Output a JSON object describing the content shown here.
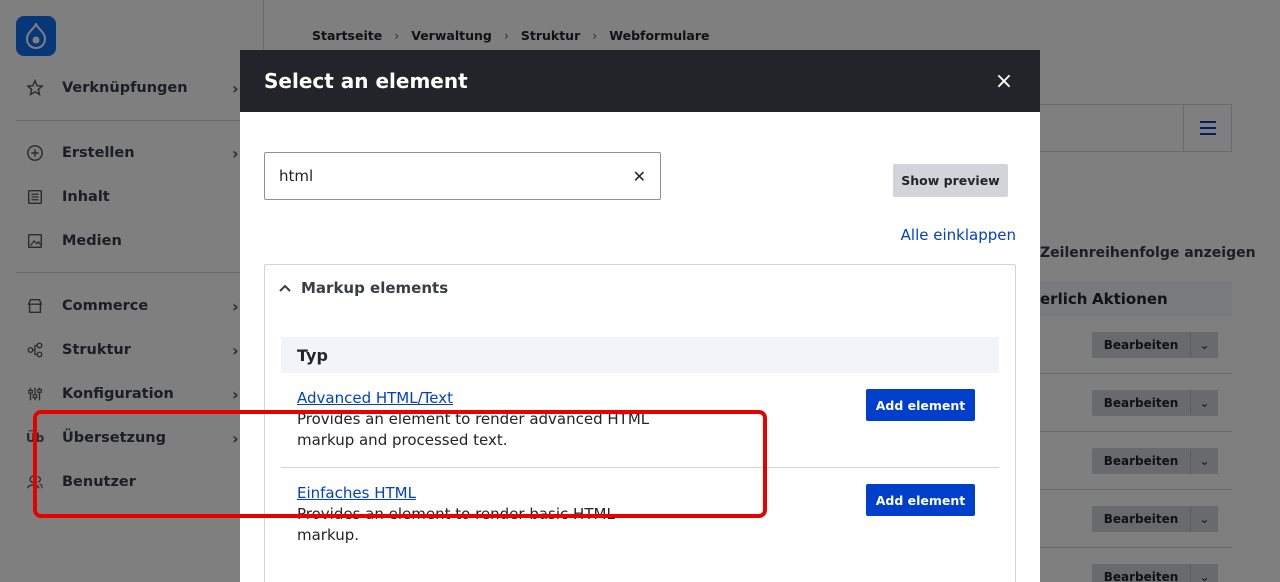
{
  "sidebar": {
    "items": [
      {
        "label": "Verknüpfungen",
        "icon": "star-icon",
        "chevron": true
      },
      {
        "label": "Erstellen",
        "icon": "plus-circle-icon",
        "chevron": true
      },
      {
        "label": "Inhalt",
        "icon": "document-list-icon",
        "chevron": false
      },
      {
        "label": "Medien",
        "icon": "image-icon",
        "chevron": false
      },
      {
        "label": "Commerce",
        "icon": "store-icon",
        "chevron": true
      },
      {
        "label": "Struktur",
        "icon": "structure-icon",
        "chevron": true
      },
      {
        "label": "Konfiguration",
        "icon": "sliders-icon",
        "chevron": true
      },
      {
        "label": "Übersetzung",
        "icon": "translate-icon",
        "chevron": true
      },
      {
        "label": "Benutzer",
        "icon": "users-icon",
        "chevron": false
      }
    ]
  },
  "breadcrumb": [
    "Startseite",
    "Verwaltung",
    "Struktur",
    "Webformulare"
  ],
  "background": {
    "order_link": "Zeilenreihenfolge anzeigen",
    "col_required": "erlich",
    "col_actions": "Aktionen",
    "edit_label": "Bearbeiten"
  },
  "dialog": {
    "title": "Select an element",
    "search": {
      "value": "html",
      "placeholder": ""
    },
    "preview_button": "Show preview",
    "collapse_link": "Alle einklappen",
    "group_title": "Markup elements",
    "table_header": "Typ",
    "elements": [
      {
        "name": "Advanced HTML/Text",
        "description": "Provides an element to render advanced HTML markup and processed text.",
        "button": "Add element"
      },
      {
        "name": "Einfaches HTML",
        "description": "Provides an element to render basic HTML markup.",
        "button": "Add element"
      }
    ]
  },
  "colors": {
    "accent": "#003ecc",
    "header": "#232429",
    "highlight": "#e60000",
    "logo": "#0f6ff2"
  }
}
